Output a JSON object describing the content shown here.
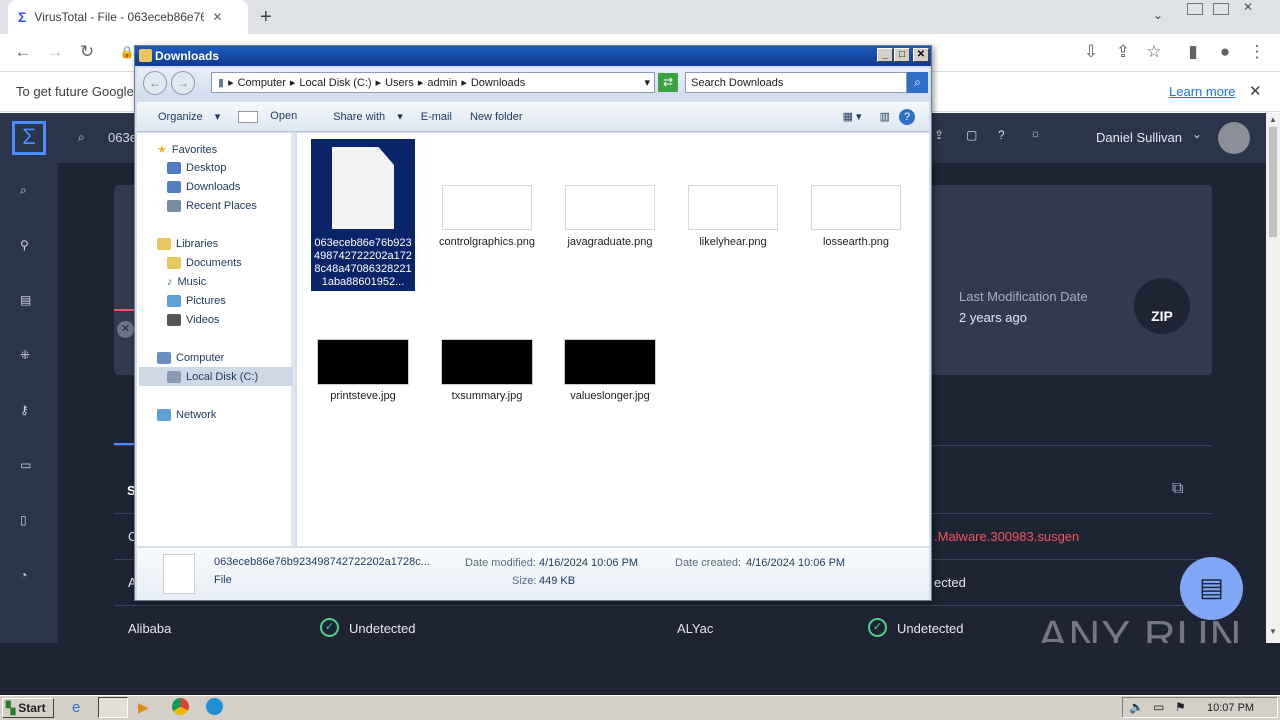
{
  "chrome": {
    "tab_title": "VirusTotal - File - 063eceb86e76b923",
    "url_text": "063e",
    "infobar_text": "To get future Google",
    "learn_more": "Learn more"
  },
  "vt": {
    "user": "Daniel Sullivan",
    "search_text": "063e",
    "last_mod_label": "Last Modification Date",
    "last_mod_value": "2 years ago",
    "zip_label": "ZIP",
    "detection_text": ".Malware.300983.susgen",
    "rows": [
      {
        "engine": "Alibaba",
        "result": "Undetected",
        "engine2": "ALYac",
        "result2": "Undetected"
      }
    ],
    "partial_right": "ected",
    "partial_left_a": "A",
    "partial_left_c": "C",
    "partial_s": "S",
    "watermark": "ANY RUN"
  },
  "explorer": {
    "title": "Downloads",
    "breadcrumb": [
      "Computer",
      "Local Disk (C:)",
      "Users",
      "admin",
      "Downloads"
    ],
    "search_placeholder": "Search Downloads",
    "commands": [
      "Organize",
      "Open",
      "Share with",
      "E-mail",
      "New folder"
    ],
    "nav": {
      "favorites": "Favorites",
      "fav_items": [
        "Desktop",
        "Downloads",
        "Recent Places"
      ],
      "libraries": "Libraries",
      "lib_items": [
        "Documents",
        "Music",
        "Pictures",
        "Videos"
      ],
      "computer": "Computer",
      "local_disk": "Local Disk (C:)",
      "network": "Network"
    },
    "files": [
      {
        "name": "063eceb86e76b923498742722202a1728c48a470863282211aba88601952...",
        "type": "generic",
        "selected": true
      },
      {
        "name": "controlgraphics.png",
        "type": "png"
      },
      {
        "name": "javagraduate.png",
        "type": "png"
      },
      {
        "name": "likelyhear.png",
        "type": "png"
      },
      {
        "name": "lossearth.png",
        "type": "png"
      },
      {
        "name": "printsteve.jpg",
        "type": "jpg"
      },
      {
        "name": "txsummary.jpg",
        "type": "jpg"
      },
      {
        "name": "valueslonger.jpg",
        "type": "jpg"
      }
    ],
    "details": {
      "name": "063eceb86e76b923498742722202a1728c...",
      "type": "File",
      "modified_label": "Date modified:",
      "modified": "4/16/2024 10:06 PM",
      "created_label": "Date created:",
      "created": "4/16/2024 10:06 PM",
      "size_label": "Size:",
      "size": "449 KB"
    }
  },
  "taskbar": {
    "start": "Start",
    "clock": "10:07 PM"
  },
  "colors": {
    "vt_bg": "#1e2434",
    "accent_red": "#f0545f",
    "selection": "#0a246a"
  }
}
